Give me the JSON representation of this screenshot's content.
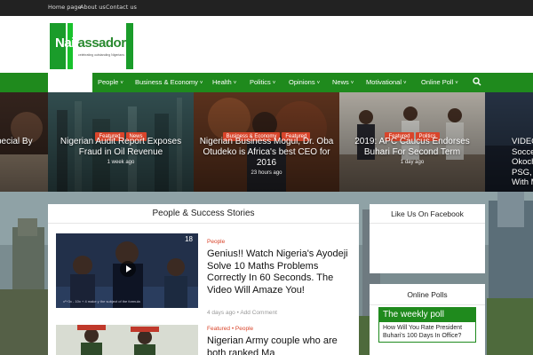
{
  "topbar": {
    "links": [
      "Home page",
      "About us",
      "Contact us"
    ]
  },
  "logo": {
    "name_part1": "Naij",
    "name_part2": "assador",
    "tagline": "celebrating outstanding Nigerians"
  },
  "nav": {
    "items": [
      "People",
      "Business & Economy",
      "Health",
      "Politics",
      "Opinions",
      "News",
      "Motivational",
      "Online Poll"
    ],
    "caret": "˅"
  },
  "slider": [
    {
      "title": "pecial By",
      "badges": [],
      "ago": ""
    },
    {
      "title": "Nigerian Audit Report Exposes Fraud in Oil Revenue",
      "badges": [
        "Featured",
        "News"
      ],
      "ago": "1 week ago"
    },
    {
      "title": "Nigerian Business Mogul, Dr. Oba Otudeko is Africa's best CEO for 2016",
      "badges": [
        "Business & Economy",
        "Featured"
      ],
      "ago": "23 hours ago"
    },
    {
      "title": "2019: APC Caucus Endorses Buhari For Second Term",
      "badges": [
        "Featured",
        "Politics"
      ],
      "ago": "1 day ago"
    },
    {
      "title": "VIDEO Soccer S Okoch PSG, A With M",
      "badges": [],
      "ago": ""
    }
  ],
  "main": {
    "section_title": "People & Success Stories",
    "posts": [
      {
        "category": "People",
        "title": "Genius!! Watch Nigeria's Ayodeji Solve 10 Maths Problems Correctly In 60 Seconds. The Video Will Amaze You!",
        "date": "4 days ago",
        "comment": "Add Comment",
        "counter": "18",
        "thumb_caption": "x²+3x - 10x + 4 make y the subject of the formula"
      },
      {
        "category": "Featured • People",
        "title": "Nigerian Army couple who are both ranked Ma"
      }
    ]
  },
  "sidebar": {
    "facebook_title": "Like Us On Facebook",
    "polls_title": "Online Polls",
    "poll_header": "The weekly poll",
    "poll_question": "How Will You Rate President Buhari's 100 Days In Office?"
  },
  "colors": {
    "green": "#1f8a1d",
    "red_badge": "#d9452b",
    "topbar": "#222222"
  }
}
